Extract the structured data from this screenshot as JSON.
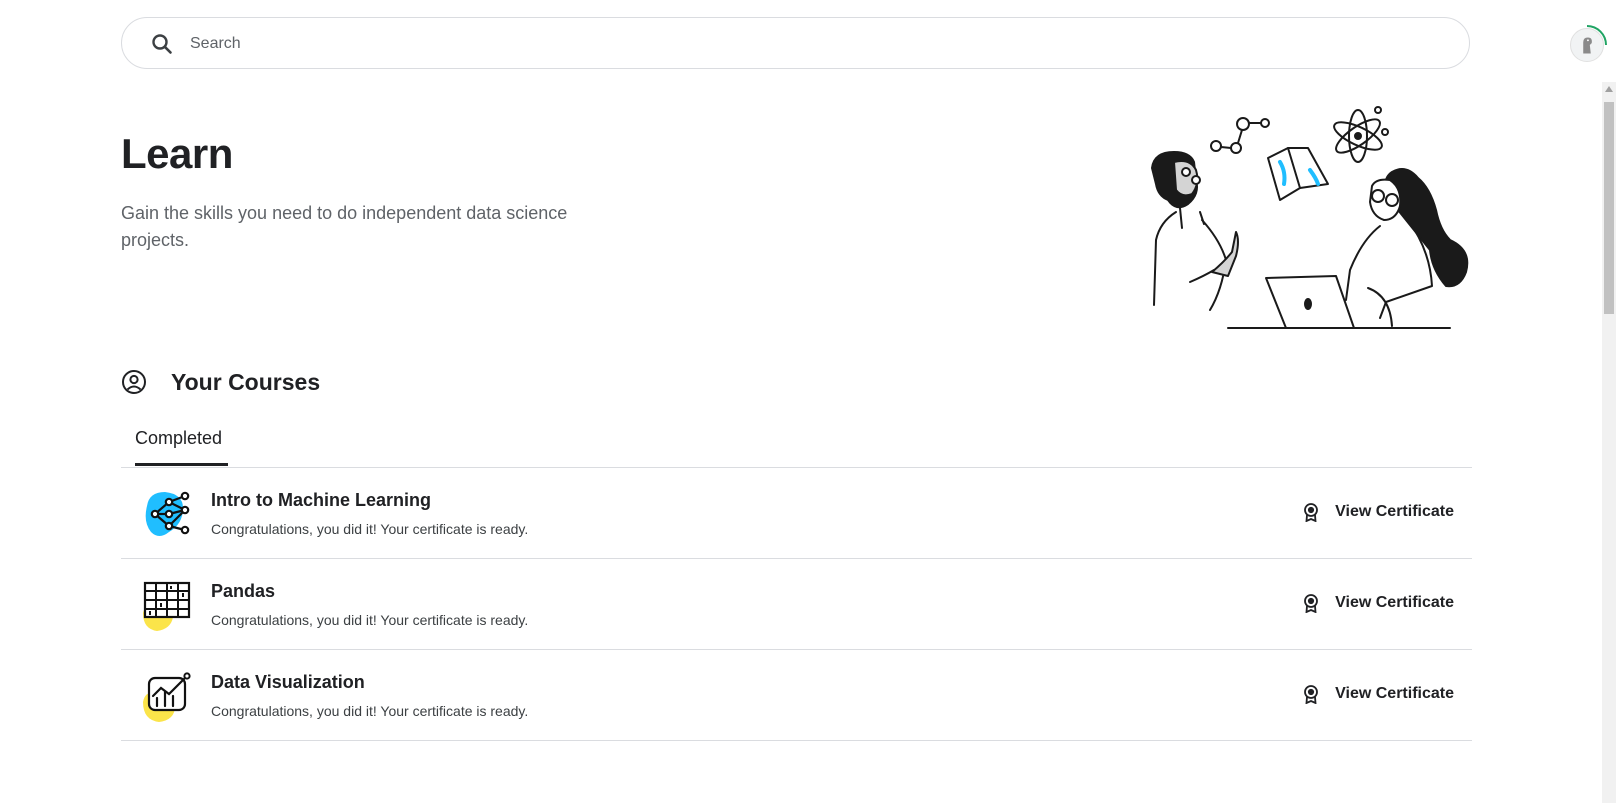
{
  "search": {
    "placeholder": "Search",
    "value": ""
  },
  "header": {
    "title": "Learn",
    "subtitle": "Gain the skills you need to do independent data science projects."
  },
  "courses": {
    "heading": "Your Courses",
    "tabs": [
      {
        "label": "Completed",
        "active": true
      }
    ],
    "items": [
      {
        "title": "Intro to Machine Learning",
        "status": "Congratulations, you did it! Your certificate is ready.",
        "action": "View Certificate",
        "icon": "ml-network-icon",
        "blob_color": "#20beff"
      },
      {
        "title": "Pandas",
        "status": "Congratulations, you did it! Your certificate is ready.",
        "action": "View Certificate",
        "icon": "table-grid-icon",
        "blob_color": "#fbe44a"
      },
      {
        "title": "Data Visualization",
        "status": "Congratulations, you did it! Your certificate is ready.",
        "action": "View Certificate",
        "icon": "chart-icon",
        "blob_color": "#fbe44a"
      }
    ]
  },
  "colors": {
    "text": "#202124",
    "muted": "#5f6368",
    "divider": "#dadce0",
    "accent_blue": "#20beff",
    "accent_yellow": "#fbe44a",
    "progress_green": "#20a464"
  }
}
